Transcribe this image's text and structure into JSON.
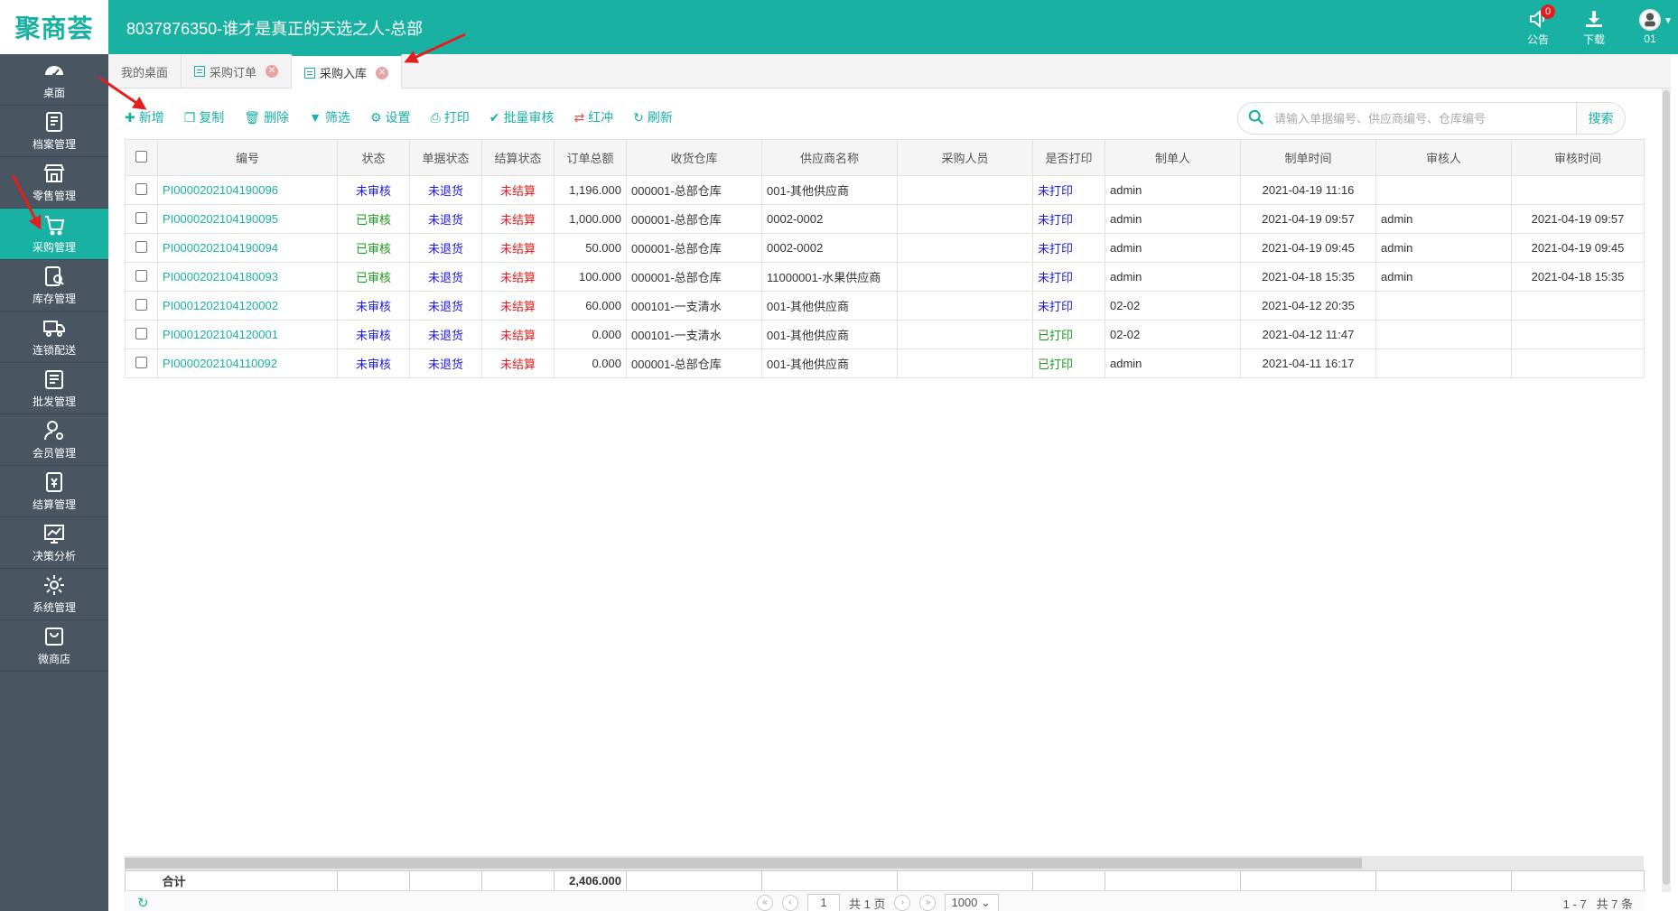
{
  "header": {
    "logo_text": "聚商荟",
    "store_title": "8037876350-谁才是真正的天选之人-总部",
    "notice_label": "公告",
    "notice_count": "0",
    "download_label": "下载",
    "user_label": "01"
  },
  "sidebar": {
    "items": [
      {
        "label": "桌面",
        "icon": "dashboard-icon"
      },
      {
        "label": "档案管理",
        "icon": "archive-icon"
      },
      {
        "label": "零售管理",
        "icon": "store-icon"
      },
      {
        "label": "采购管理",
        "icon": "purchase-icon",
        "active": true
      },
      {
        "label": "库存管理",
        "icon": "inventory-icon"
      },
      {
        "label": "连锁配送",
        "icon": "truck-icon"
      },
      {
        "label": "批发管理",
        "icon": "wholesale-icon"
      },
      {
        "label": "会员管理",
        "icon": "member-icon"
      },
      {
        "label": "结算管理",
        "icon": "settlement-icon"
      },
      {
        "label": "决策分析",
        "icon": "chart-icon"
      },
      {
        "label": "系统管理",
        "icon": "gear-icon"
      },
      {
        "label": "微商店",
        "icon": "shop-bag-icon"
      }
    ]
  },
  "tabs": [
    {
      "label": "我的桌面"
    },
    {
      "label": "采购订单"
    },
    {
      "label": "采购入库",
      "active": true
    }
  ],
  "toolbar": {
    "add": "新增",
    "copy": "复制",
    "delete": "删除",
    "filter": "筛选",
    "settings": "设置",
    "print": "打印",
    "batch_audit": "批量审核",
    "red_offset": "红冲",
    "refresh": "刷新"
  },
  "search": {
    "placeholder": "请输入单据编号、供应商编号、仓库编号",
    "button": "搜索"
  },
  "table": {
    "columns": [
      "编号",
      "状态",
      "单据状态",
      "结算状态",
      "订单总额",
      "收货仓库",
      "供应商名称",
      "采购人员",
      "是否打印",
      "制单人",
      "制单时间",
      "审核人",
      "审核时间"
    ],
    "rows": [
      {
        "id": "PI0000202104190096",
        "status": "未审核",
        "doc_status": "未退货",
        "settle": "未结算",
        "amount": "1,196.000",
        "warehouse": "000001-总部仓库",
        "supplier": "001-其他供应商",
        "buyer": "",
        "printed": "未打印",
        "creator": "admin",
        "created": "2021-04-19 11:16",
        "auditor": "",
        "audited": ""
      },
      {
        "id": "PI0000202104190095",
        "status": "已审核",
        "doc_status": "未退货",
        "settle": "未结算",
        "amount": "1,000.000",
        "warehouse": "000001-总部仓库",
        "supplier": "0002-0002",
        "buyer": "",
        "printed": "未打印",
        "creator": "admin",
        "created": "2021-04-19 09:57",
        "auditor": "admin",
        "audited": "2021-04-19 09:57"
      },
      {
        "id": "PI0000202104190094",
        "status": "已审核",
        "doc_status": "未退货",
        "settle": "未结算",
        "amount": "50.000",
        "warehouse": "000001-总部仓库",
        "supplier": "0002-0002",
        "buyer": "",
        "printed": "未打印",
        "creator": "admin",
        "created": "2021-04-19 09:45",
        "auditor": "admin",
        "audited": "2021-04-19 09:45"
      },
      {
        "id": "PI0000202104180093",
        "status": "已审核",
        "doc_status": "未退货",
        "settle": "未结算",
        "amount": "100.000",
        "warehouse": "000001-总部仓库",
        "supplier": "11000001-水果供应商",
        "buyer": "",
        "printed": "未打印",
        "creator": "admin",
        "created": "2021-04-18 15:35",
        "auditor": "admin",
        "audited": "2021-04-18 15:35"
      },
      {
        "id": "PI0001202104120002",
        "status": "未审核",
        "doc_status": "未退货",
        "settle": "未结算",
        "amount": "60.000",
        "warehouse": "000101-一支清水",
        "supplier": "001-其他供应商",
        "buyer": "",
        "printed": "未打印",
        "creator": "02-02",
        "created": "2021-04-12 20:35",
        "auditor": "",
        "audited": ""
      },
      {
        "id": "PI0001202104120001",
        "status": "未审核",
        "doc_status": "未退货",
        "settle": "未结算",
        "amount": "0.000",
        "warehouse": "000101-一支清水",
        "supplier": "001-其他供应商",
        "buyer": "",
        "printed": "已打印",
        "creator": "02-02",
        "created": "2021-04-12 11:47",
        "auditor": "",
        "audited": ""
      },
      {
        "id": "PI0000202104110092",
        "status": "未审核",
        "doc_status": "未退货",
        "settle": "未结算",
        "amount": "0.000",
        "warehouse": "000001-总部仓库",
        "supplier": "001-其他供应商",
        "buyer": "",
        "printed": "已打印",
        "creator": "admin",
        "created": "2021-04-11 16:17",
        "auditor": "",
        "audited": ""
      }
    ]
  },
  "summary": {
    "label": "合计",
    "total_amount": "2,406.000"
  },
  "pager": {
    "current_page": "1",
    "total_pages": "共 1 页",
    "page_size": "1000",
    "range": "1 - 7",
    "total_count": "共 7 条"
  },
  "colors": {
    "brand": "#19b1a2",
    "sidebar": "#4a5562",
    "blue_status": "#1a1ae0",
    "green_status": "#1a9a1a",
    "red_status": "#e02020",
    "annotation_arrow": "#e02020"
  }
}
